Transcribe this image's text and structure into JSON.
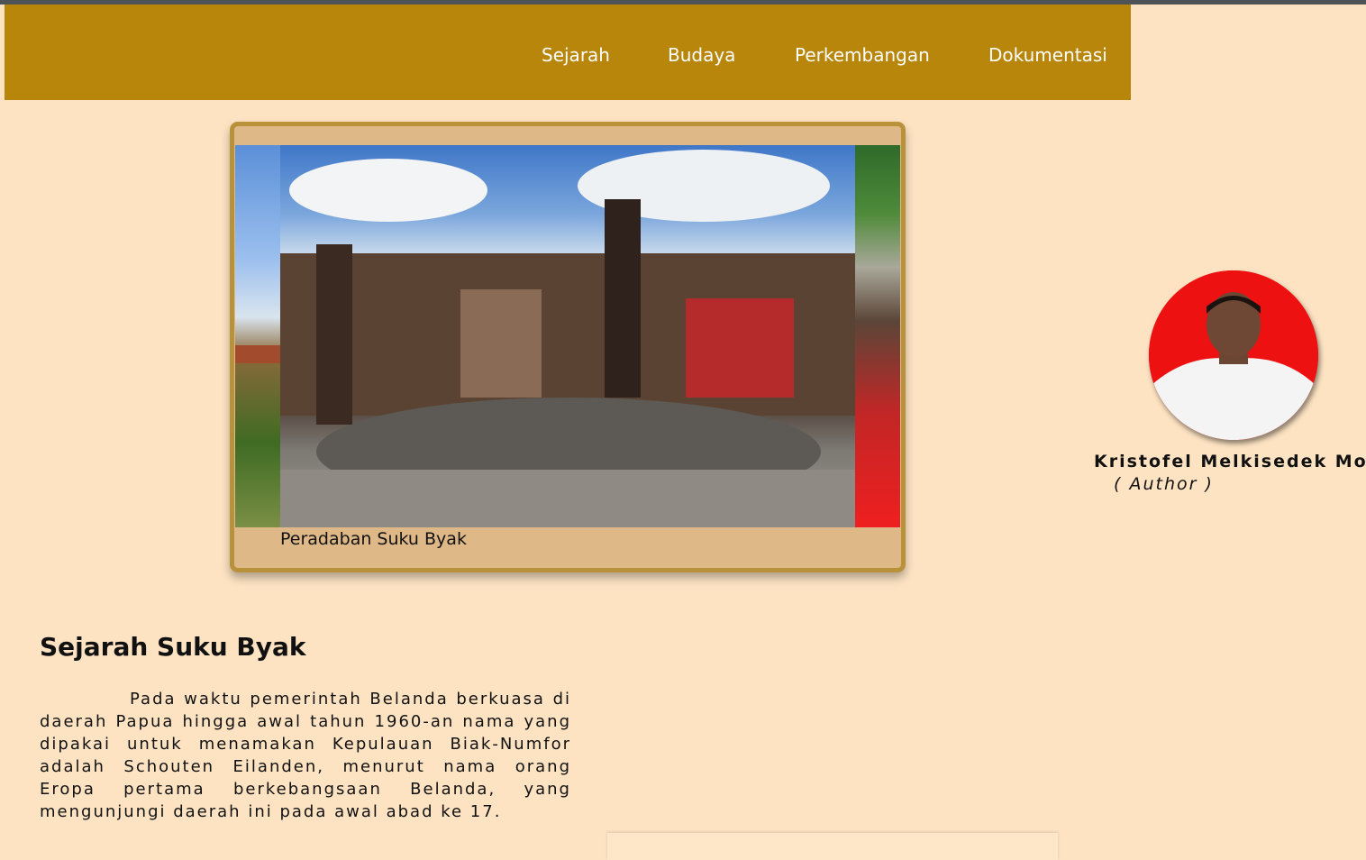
{
  "nav": {
    "items": [
      {
        "label": "Sejarah"
      },
      {
        "label": "Budaya"
      },
      {
        "label": "Perkembangan"
      },
      {
        "label": "Dokumentasi"
      }
    ]
  },
  "slider": {
    "caption": "Peradaban Suku Byak"
  },
  "author": {
    "name": "Kristofel Melkisedek Morin",
    "role": "( Author )"
  },
  "section": {
    "title": "Sejarah Suku Byak",
    "body": "Pada waktu pemerintah Belanda berkuasa di daerah Papua hingga awal tahun 1960-an nama yang dipakai untuk menamakan Kepulauan Biak-Numfor adalah Schouten Eilanden, menurut nama orang Eropa pertama berkebangsaan Belanda, yang mengunjungi daerah ini pada awal abad ke 17."
  },
  "colors": {
    "navbar": "#b8860b",
    "page_background": "#fde3c2",
    "slider_frame": "#deb887",
    "slider_border": "#b8913a"
  }
}
